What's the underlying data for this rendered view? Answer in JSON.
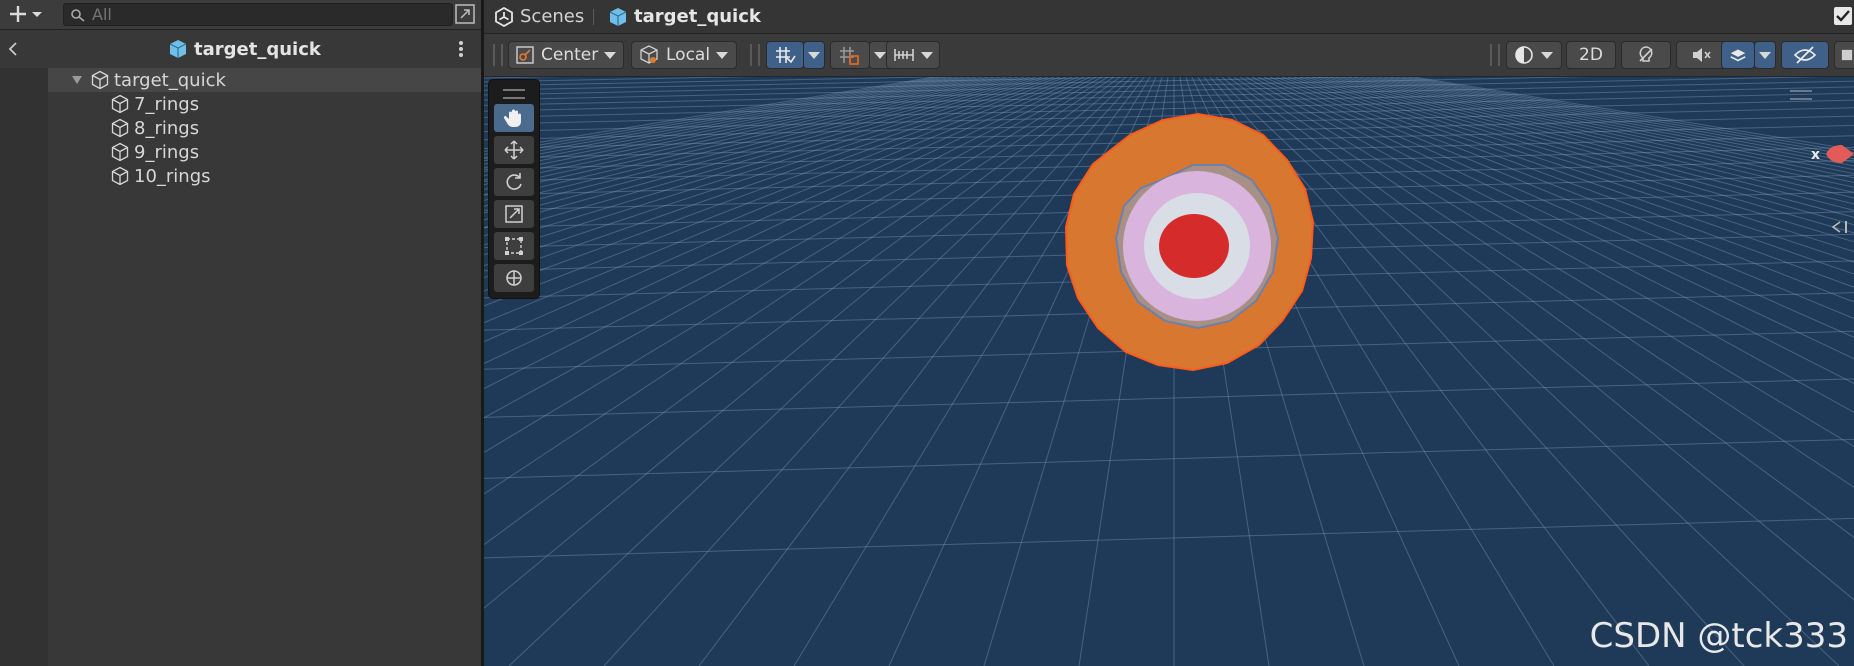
{
  "hierarchy": {
    "search_placeholder": "All",
    "title": "target_quick",
    "items": [
      {
        "label": "target_quick"
      },
      {
        "label": "7_rings"
      },
      {
        "label": "8_rings"
      },
      {
        "label": "9_rings"
      },
      {
        "label": "10_rings"
      }
    ]
  },
  "scene": {
    "tabs": [
      {
        "label": "Scenes"
      },
      {
        "label": "target_quick"
      }
    ],
    "toolbar": {
      "pivot_label": "Center",
      "space_label": "Local",
      "mode_2d_label": "2D"
    },
    "gizmo_axis_label": "x"
  },
  "watermark": "CSDN @tck333",
  "colors": {
    "accent_blue": "#6fbfe8",
    "ring_outer": "#d8772f",
    "ring_2": "#a89086",
    "ring_3": "#d9b4dc",
    "ring_4": "#d8dde6",
    "bullseye": "#d62b2b",
    "sky": "#1f3a58"
  }
}
